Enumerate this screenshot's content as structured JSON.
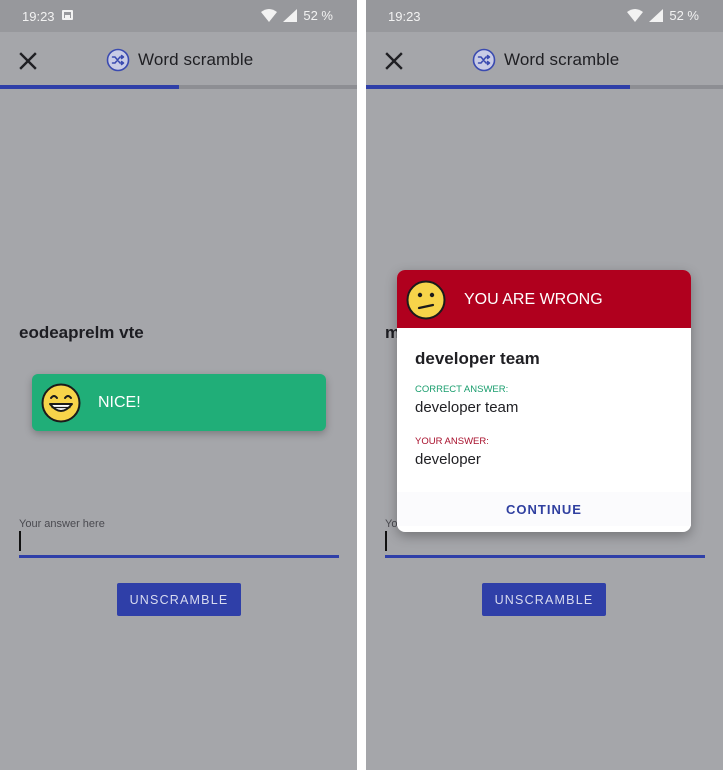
{
  "status_bar": {
    "time": "19:23",
    "battery": "52 %"
  },
  "app_bar": {
    "title": "Word scramble"
  },
  "progress": {
    "left_fraction": 0.5,
    "right_fraction": 0.74
  },
  "left_screen": {
    "scrambled_word": "eodeaprelm vte",
    "toast_text": "NICE!",
    "answer_placeholder": "Your answer here",
    "unscramble_label": "UNSCRAMBLE"
  },
  "right_screen": {
    "scrambled_word_visible": "m",
    "answer_placeholder_visible": "Yo",
    "unscramble_label": "UNSCRAMBLE",
    "dialog": {
      "title": "YOU ARE WRONG",
      "phrase": "developer team",
      "correct_label": "CORRECT ANSWER:",
      "correct_value": "developer team",
      "your_label": "YOUR ANSWER:",
      "your_value": "developer",
      "continue_label": "CONTINUE"
    }
  },
  "colors": {
    "accent": "#2f3fa8",
    "success": "#20ae78",
    "error": "#b0001e",
    "overlay": "#a5a6aa"
  },
  "icons": {
    "close": "close-icon",
    "shuffle": "shuffle-icon",
    "grin": "grin-emoji-icon",
    "confused": "confused-emoji-icon"
  }
}
